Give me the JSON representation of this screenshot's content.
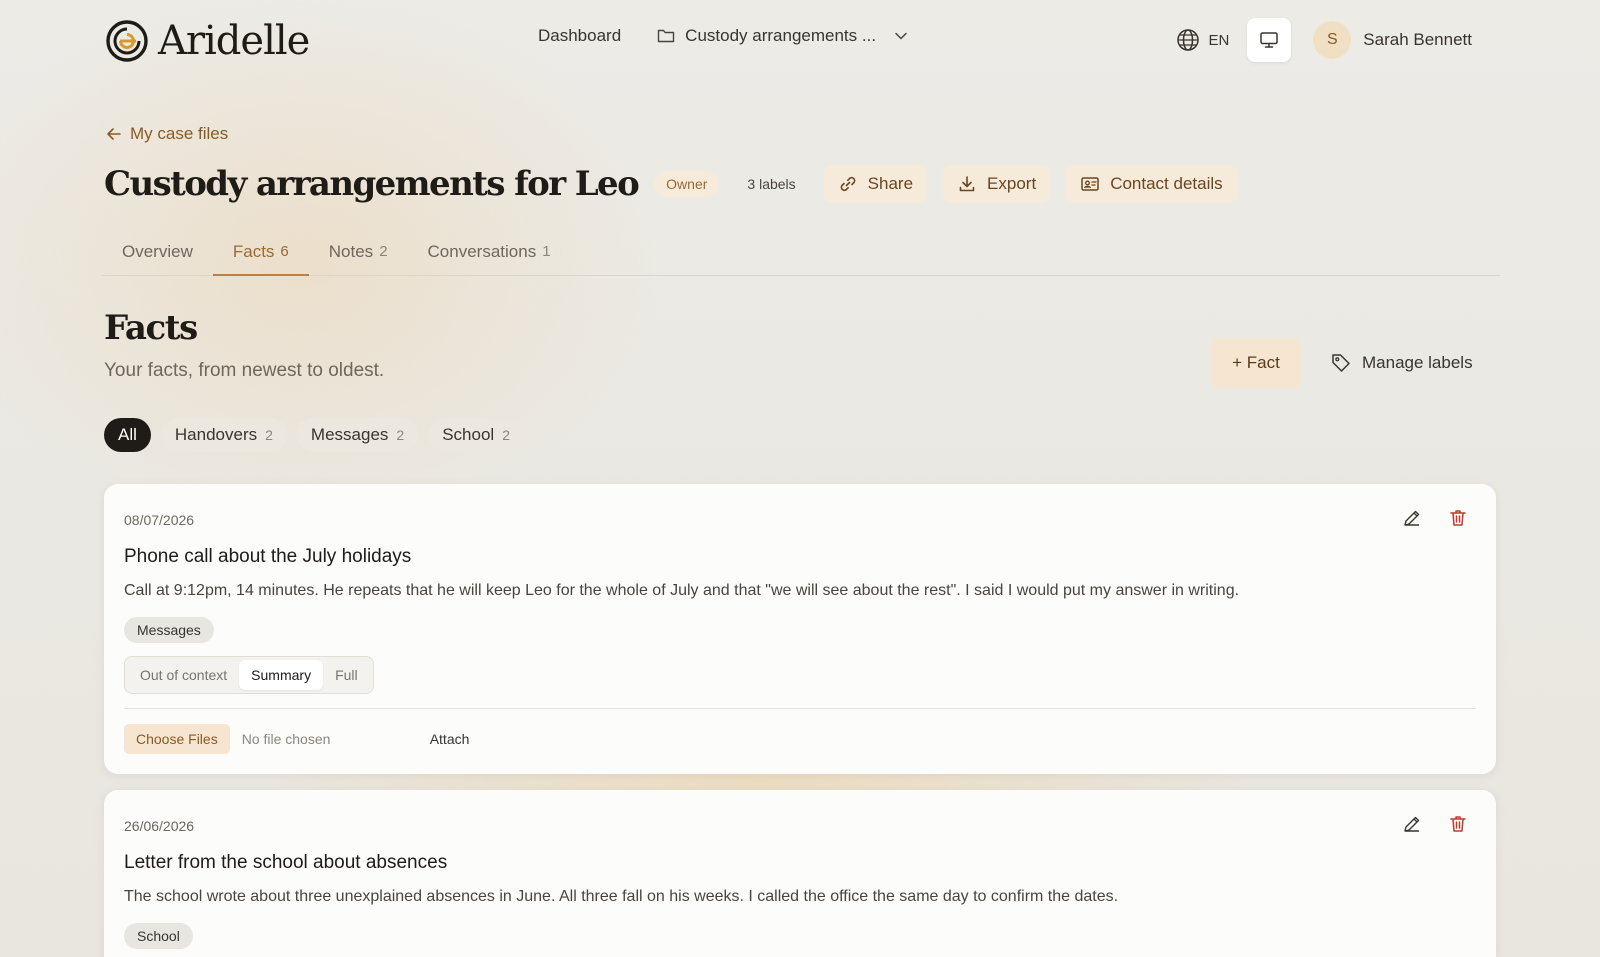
{
  "brand": {
    "name": "Aridelle"
  },
  "nav": {
    "dashboard": "Dashboard",
    "case_switch": "Custody arrangements ...",
    "language": "EN",
    "user_initial": "S",
    "user_name": "Sarah Bennett"
  },
  "header": {
    "back_label": "My case files",
    "title": "Custody arrangements for Leo",
    "owner_badge": "Owner",
    "labels_count": "3 labels",
    "share_label": "Share",
    "export_label": "Export",
    "contact_label": "Contact details"
  },
  "tabs": [
    {
      "label": "Overview",
      "count": ""
    },
    {
      "label": "Facts",
      "count": "6"
    },
    {
      "label": "Notes",
      "count": "2"
    },
    {
      "label": "Conversations",
      "count": "1"
    }
  ],
  "facts": {
    "title": "Facts",
    "subtitle": "Your facts, from newest to oldest.",
    "add_label": "+ Fact",
    "manage_labels": "Manage labels",
    "filters": [
      {
        "label": "All",
        "count": ""
      },
      {
        "label": "Handovers",
        "count": "2"
      },
      {
        "label": "Messages",
        "count": "2"
      },
      {
        "label": "School",
        "count": "2"
      }
    ],
    "items": [
      {
        "date": "08/07/2026",
        "title": "Phone call about the July holidays",
        "body": "Call at 9:12pm, 14 minutes. He repeats that he will keep Leo for the whole of July and that \"we will see about the rest\". I said I would put my answer in writing.",
        "tag": "Messages",
        "views": [
          "Out of context",
          "Summary",
          "Full"
        ],
        "choose_files": "Choose Files",
        "no_file": "No file chosen",
        "attach": "Attach"
      },
      {
        "date": "26/06/2026",
        "title": "Letter from the school about absences",
        "body": "The school wrote about three unexplained absences in June. All three fall on his weeks. I called the office the same day to confirm the dates.",
        "tag": "School"
      }
    ]
  },
  "colors": {
    "accent": "#9a6a33",
    "accent_soft": "#f6ebdb",
    "delete": "#c0392b",
    "ink": "#1f1b17"
  }
}
